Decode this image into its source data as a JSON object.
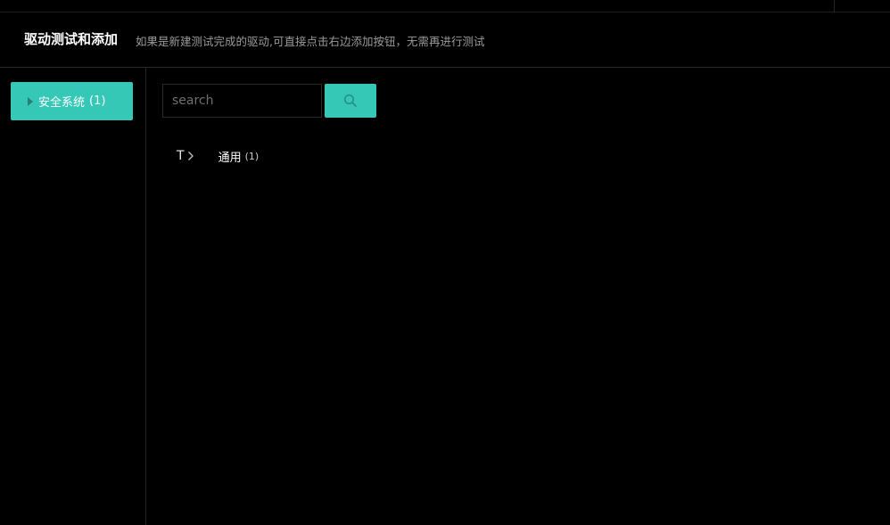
{
  "header": {
    "title": "驱动测试和添加",
    "subtitle": "如果是新建测试完成的驱动,可直接点击右边添加按钮，无需再进行测试"
  },
  "sidebar": {
    "items": [
      {
        "label": "安全系统",
        "count": "(1)",
        "icon": "caret-right-icon"
      }
    ]
  },
  "search": {
    "placeholder": "search",
    "value": "",
    "button_icon": "search-icon"
  },
  "categories": [
    {
      "type_letter": "T",
      "label": "通用",
      "count": "(1)",
      "icon": "chevron-right-icon"
    }
  ],
  "colors": {
    "accent": "#36c8b7",
    "background": "#000000",
    "subtitle": "#9a9a9a"
  }
}
